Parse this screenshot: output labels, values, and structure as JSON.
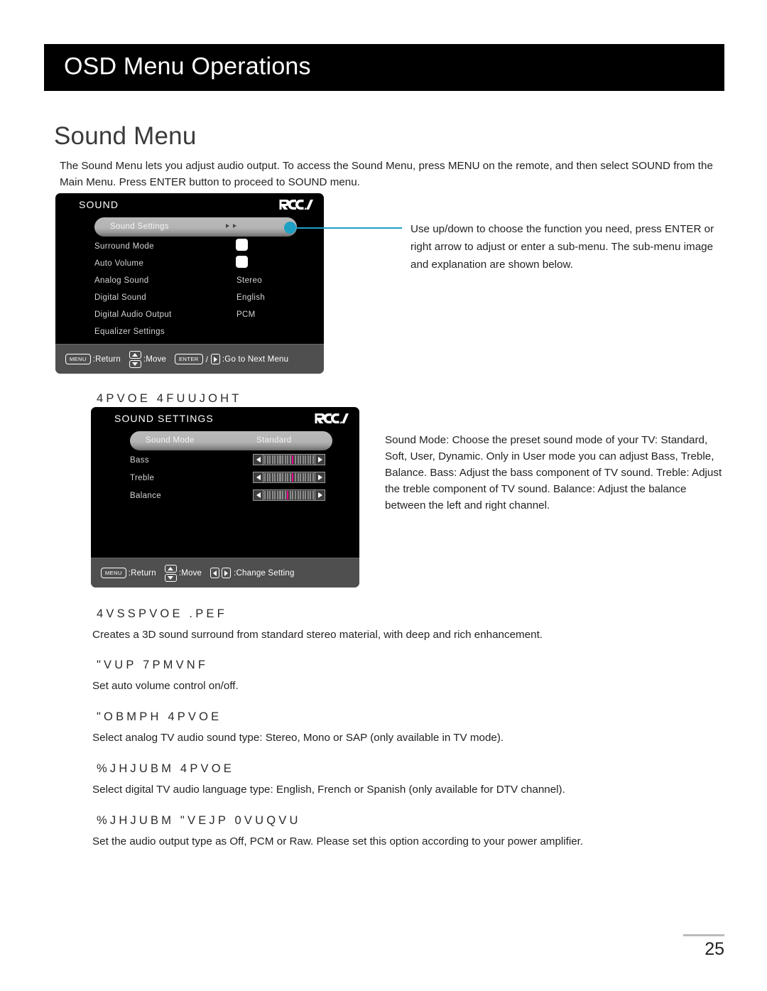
{
  "header": {
    "title": "OSD Menu Operations"
  },
  "page": {
    "title": "Sound Menu",
    "intro": "The Sound Menu lets you adjust audio output. To access the Sound Menu, press MENU on the remote, and then select SOUND from the Main Menu. Press ENTER button to proceed to SOUND menu.",
    "number": "25"
  },
  "colors": {
    "callout": "#1f9fc4",
    "slider_marker": "#ec008c",
    "header_band": "#000000",
    "osd_background": "#000000",
    "osd_footer": "#4f4f4f"
  },
  "osd_sound": {
    "brand": "RCA",
    "title": "SOUND",
    "highlighted": {
      "label": "Sound Settings",
      "arrows": "double-right-arrow"
    },
    "rows": [
      {
        "label": "Surround Mode",
        "value": "",
        "control": "checkbox"
      },
      {
        "label": "Auto Volume",
        "value": "",
        "control": "checkbox"
      },
      {
        "label": "Analog Sound",
        "value": "Stereo",
        "control": "text"
      },
      {
        "label": "Digital Sound",
        "value": "English",
        "control": "text"
      },
      {
        "label": "Digital Audio Output",
        "value": "PCM",
        "control": "text"
      },
      {
        "label": "Equalizer Settings",
        "value": "",
        "control": "none"
      }
    ],
    "footer": {
      "menu_key": "MENU",
      "menu_action": ":Return",
      "move_action": ":Move",
      "enter_key": "ENTER",
      "separator": "/",
      "next_action": ":Go to Next Menu"
    }
  },
  "osd_sound_settings": {
    "brand": "RCA",
    "title": "SOUND SETTINGS",
    "highlighted": {
      "label": "Sound Mode",
      "value": "Standard"
    },
    "sliders": [
      {
        "label": "Bass",
        "segments": 20,
        "marker_index": 11
      },
      {
        "label": "Treble",
        "segments": 20,
        "marker_index": 11
      },
      {
        "label": "Balance",
        "segments": 20,
        "marker_index": 9
      }
    ],
    "footer": {
      "menu_key": "MENU",
      "menu_action": ":Return",
      "move_action": ":Move",
      "change_action": ":Change Setting"
    }
  },
  "callout": {
    "text": "Use up/down to choose the function you need, press ENTER or right arrow to adjust or enter a sub-menu. The sub-menu image and explanation are shown below."
  },
  "sections": [
    {
      "heading": "4PVOE 4FUUJOHT",
      "body": "Sound Mode: Choose the preset sound mode of your TV: Standard, Soft, User, Dynamic. Only in User mode you can adjust Bass, Treble, Balance.\nBass: Adjust the bass component of TV sound.\nTreble: Adjust the treble component of TV sound.\nBalance: Adjust the balance between the left and right channel."
    },
    {
      "heading": "4VSSPVOE .PEF",
      "body": "Creates a 3D sound surround from standard stereo material, with deep and rich enhancement."
    },
    {
      "heading": "\"VUP 7PMVNF",
      "body": "Set auto volume control on/off."
    },
    {
      "heading": "\"OBMPH 4PVOE",
      "body": "Select analog TV audio sound type: Stereo, Mono or SAP (only available in TV mode)."
    },
    {
      "heading": "%JHJUBM 4PVOE",
      "body": "Select digital TV audio language type: English, French or Spanish (only available for DTV channel)."
    },
    {
      "heading": "%JHJUBM \"VEJP 0VUQVU",
      "body": "Set the audio output type as Off, PCM or Raw. Please set this option according to your power amplifier."
    }
  ]
}
